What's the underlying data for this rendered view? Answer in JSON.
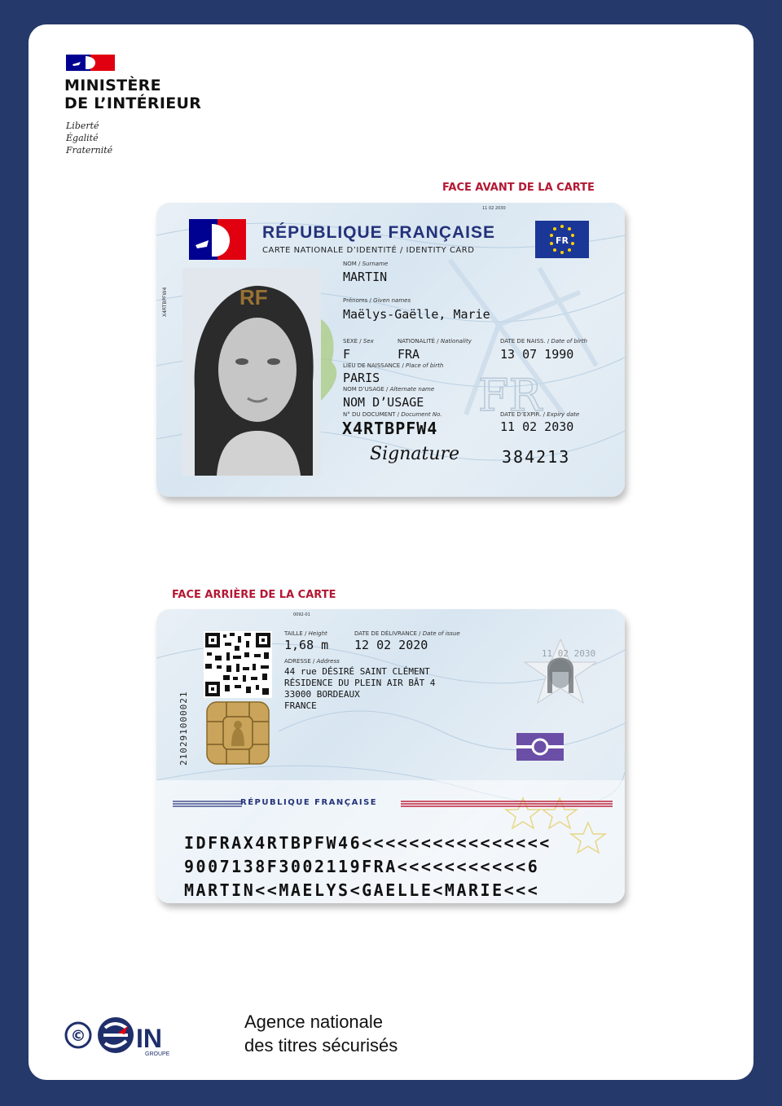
{
  "header": {
    "ministry_line1": "MINISTÈRE",
    "ministry_line2": "DE L’INTÉRIEUR",
    "motto": [
      "Liberté",
      "Égalité",
      "Fraternité"
    ]
  },
  "labels": {
    "front": "FACE AVANT DE LA CARTE",
    "back": "FACE ARRIÈRE DE LA CARTE"
  },
  "front": {
    "header": "RÉPUBLIQUE FRANÇAISE",
    "subheader": "CARTE NATIONALE D’IDENTITÉ / IDENTITY CARD",
    "eu_code": "FR",
    "ghost": "RF",
    "surname_label": "NOM /",
    "surname_label_en": "Surname",
    "surname": "MARTIN",
    "given_label": "Prénoms /",
    "given_label_en": "Given names",
    "given": "Maëlys-Gaëlle, Marie",
    "sex_label": "SEXE /",
    "sex_label_en": "Sex",
    "sex": "F",
    "nat_label": "NATIONALITÉ /",
    "nat_label_en": "Nationality",
    "nationality": "FRA",
    "dob_label": "DATE DE NAISS. /",
    "dob_label_en": "Date of birth",
    "dob": "13 07 1990",
    "pob_label": "LIEU DE NAISSANCE /",
    "pob_label_en": "Place of birth",
    "pob": "PARIS",
    "usage_label": "NOM D’USAGE /",
    "usage_label_en": "Alternate name",
    "usage": "NOM D’USAGE",
    "doc_label": "N° DU DOCUMENT /",
    "doc_label_en": "Document No.",
    "doc_number": "X4RTBPFW4",
    "exp_label": "DATE D’EXPIR. /",
    "exp_label_en": "Expiry date",
    "expiry": "11 02 2030",
    "signature": "Signature",
    "can": "384213",
    "side_code": "X4RTBPFW4",
    "top_small": "11 02 2030"
  },
  "back": {
    "height_label": "TAILLE /",
    "height_label_en": "Height",
    "height": "1,68 m",
    "issue_label": "DATE DE DÉLIVRANCE /",
    "issue_label_en": "Date of issue",
    "issue_date": "12 02 2020",
    "address_label": "ADRESSE /",
    "address_label_en": "Address",
    "address": [
      "44 rue DÉSIRÉ SAINT CLÉMENT",
      "RÉSIDENCE DU PLEIN AIR BÂT 4",
      "33000 BORDEAUX",
      "FRANCE"
    ],
    "vertical_number": "210291000021",
    "ghost_date": "11 02 2030",
    "top_small": "0092-01",
    "band": "RÉPUBLIQUE FRANÇAISE",
    "mrz": [
      "IDFRAX4RTBPFW46<<<<<<<<<<<<<<<<",
      "9007138F3002119FRA<<<<<<<<<<<6",
      "MARTIN<<MAELYS<GAELLE<MARIE<<<"
    ]
  },
  "footer": {
    "copyright": "©",
    "brand": "IN",
    "brand_sub": "GROUPE",
    "agency_line1": "Agence nationale",
    "agency_line2": "des titres sécurisés"
  },
  "colors": {
    "frame": "#26396b",
    "accent_red": "#b31833",
    "rf_blue": "#24327a",
    "flag_blue": "#000091",
    "flag_red": "#e1000f"
  }
}
